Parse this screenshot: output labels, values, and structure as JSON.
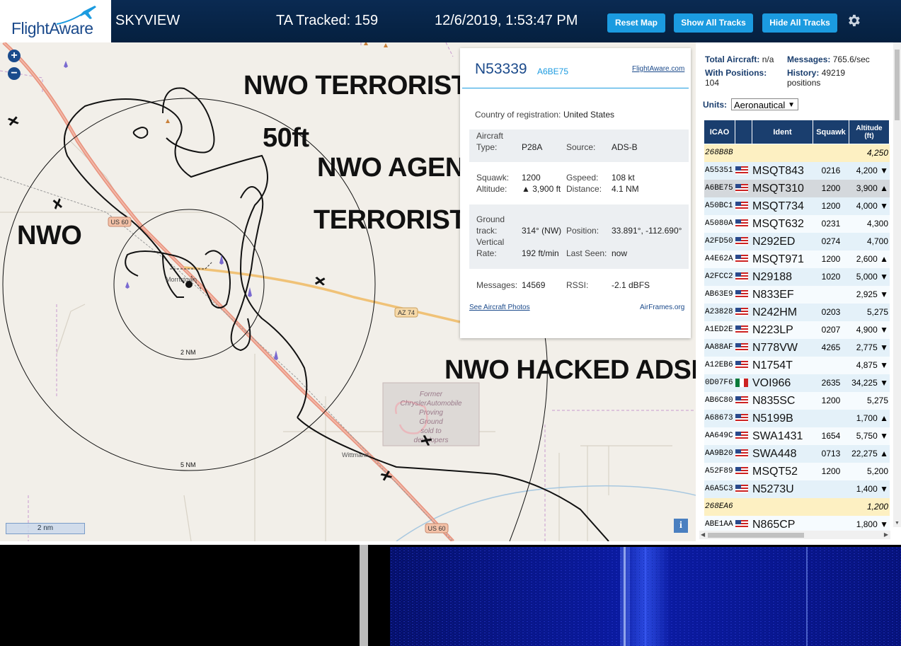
{
  "header": {
    "logo_text": "FlightAware",
    "app_name": "SKYVIEW",
    "tracked_label": "TA Tracked: 159",
    "datetime": "12/6/2019, 1:53:47 PM",
    "reset_map": "Reset Map",
    "show_all": "Show All Tracks",
    "hide_all": "Hide All Tracks",
    "settings_icon": "gear-icon"
  },
  "map": {
    "zoom_in": "+",
    "zoom_out": "−",
    "scale": "2 nm",
    "info": "i",
    "overlays": [
      "NWO TERRORIST",
      "50ft",
      "NWO AGENT",
      "TERRORIST",
      "NWO",
      "NWO HACKED ADSB"
    ],
    "labels": {
      "us60_a": "US 60",
      "us60_b": "US 60",
      "az74": "AZ 74",
      "morristown": "Morristown",
      "wittmann": "Wittmann",
      "ring_2nm": "2 NM",
      "ring_5nm": "5 NM",
      "proving_ground": [
        "Former",
        "ChryslerAutomobile",
        "Proving",
        "Ground",
        "sold to",
        "developers"
      ]
    }
  },
  "popup": {
    "registration": "N53339",
    "hex": "A6BE75",
    "fa_link": "FlightAware.com",
    "country_label": "Country of registration:",
    "country": "United States",
    "aircraft_type_label": [
      "Aircraft",
      "Type:"
    ],
    "aircraft_type": "P28A",
    "source_label": "Source:",
    "source": "ADS-B",
    "squawk_label": "Squawk:",
    "squawk": "1200",
    "gspeed_label": "Gspeed:",
    "gspeed": "108 kt",
    "altitude_label": "Altitude:",
    "altitude": "▲ 3,900 ft",
    "distance_label": "Distance:",
    "distance": "4.1 NM",
    "track_label": [
      "Ground",
      "track:"
    ],
    "track": "314° (NW)",
    "position_label": "Position:",
    "position": "33.891°, -112.690°",
    "vrate_label": [
      "Vertical",
      "Rate:"
    ],
    "vrate": "192 ft/min",
    "lastseen_label": "Last Seen:",
    "lastseen": "now",
    "messages_label": "Messages:",
    "messages": "14569",
    "rssi_label": "RSSI:",
    "rssi": "-2.1 dBFS",
    "photos_link": "See Aircraft Photos",
    "airframes_link": "AirFrames.org"
  },
  "sidebar": {
    "total_label": "Total Aircraft:",
    "total": "n/a",
    "messages_label": "Messages:",
    "messages": "765.6/sec",
    "withpos_label": "With Positions:",
    "withpos": "104",
    "history_label": "History:",
    "history": "49219",
    "history_unit": "positions",
    "units_label": "Units:",
    "units_value": "Aeronautical",
    "columns": [
      "ICAO",
      "",
      "Ident",
      "Squawk",
      "Altitude (ft)"
    ],
    "rows": [
      {
        "icao": "268B8B",
        "flag": "",
        "ident": "",
        "squawk": "",
        "alt": "4,250",
        "style": "mlat"
      },
      {
        "icao": "A55351",
        "flag": "us",
        "ident": "MSQT843",
        "squawk": "0216",
        "alt": "4,200 ▼",
        "style": "a"
      },
      {
        "icao": "A6BE75",
        "flag": "us",
        "ident": "MSQT310",
        "squawk": "1200",
        "alt": "3,900 ▲",
        "style": "sel"
      },
      {
        "icao": "A50BC1",
        "flag": "us",
        "ident": "MSQT734",
        "squawk": "1200",
        "alt": "4,000 ▼",
        "style": "a"
      },
      {
        "icao": "A5080A",
        "flag": "us",
        "ident": "MSQT632",
        "squawk": "0231",
        "alt": "4,300",
        "style": "b"
      },
      {
        "icao": "A2FD50",
        "flag": "us",
        "ident": "N292ED",
        "squawk": "0274",
        "alt": "4,700",
        "style": "a"
      },
      {
        "icao": "A4E62A",
        "flag": "us",
        "ident": "MSQT971",
        "squawk": "1200",
        "alt": "2,600 ▲",
        "style": "b"
      },
      {
        "icao": "A2FCC2",
        "flag": "us",
        "ident": "N29188",
        "squawk": "1020",
        "alt": "5,000 ▼",
        "style": "a"
      },
      {
        "icao": "AB63E9",
        "flag": "us",
        "ident": "N833EF",
        "squawk": "",
        "alt": "2,925 ▼",
        "style": "b"
      },
      {
        "icao": "A23828",
        "flag": "us",
        "ident": "N242HM",
        "squawk": "0203",
        "alt": "5,275",
        "style": "a"
      },
      {
        "icao": "A1ED2E",
        "flag": "us",
        "ident": "N223LP",
        "squawk": "0207",
        "alt": "4,900 ▼",
        "style": "b"
      },
      {
        "icao": "AA88AF",
        "flag": "us",
        "ident": "N778VW",
        "squawk": "4265",
        "alt": "2,775 ▼",
        "style": "a"
      },
      {
        "icao": "A12EB6",
        "flag": "us",
        "ident": "N1754T",
        "squawk": "",
        "alt": "4,875 ▼",
        "style": "b"
      },
      {
        "icao": "0D07F6",
        "flag": "mx",
        "ident": "VOI966",
        "squawk": "2635",
        "alt": "34,225 ▼",
        "style": "a"
      },
      {
        "icao": "AB6C80",
        "flag": "us",
        "ident": "N835SC",
        "squawk": "1200",
        "alt": "5,275",
        "style": "b"
      },
      {
        "icao": "A68673",
        "flag": "us",
        "ident": "N5199B",
        "squawk": "",
        "alt": "1,700 ▲",
        "style": "a"
      },
      {
        "icao": "AA649C",
        "flag": "us",
        "ident": "SWA1431",
        "squawk": "1654",
        "alt": "5,750 ▼",
        "style": "b"
      },
      {
        "icao": "AA9B20",
        "flag": "us",
        "ident": "SWA448",
        "squawk": "0713",
        "alt": "22,275 ▲",
        "style": "a"
      },
      {
        "icao": "A52F89",
        "flag": "us",
        "ident": "MSQT52",
        "squawk": "1200",
        "alt": "5,200",
        "style": "b"
      },
      {
        "icao": "A6A5C3",
        "flag": "us",
        "ident": "N5273U",
        "squawk": "",
        "alt": "1,400 ▼",
        "style": "a"
      },
      {
        "icao": "268EA6",
        "flag": "",
        "ident": "",
        "squawk": "",
        "alt": "1,200",
        "style": "mlat"
      },
      {
        "icao": "ABE1AA",
        "flag": "us",
        "ident": "N865CP",
        "squawk": "",
        "alt": "1,800 ▼",
        "style": "b"
      }
    ]
  },
  "colors": {
    "header_bg": "#0a2a52",
    "button_blue": "#1b9be0",
    "table_head": "#1a3e6e",
    "row_a": "#e4f1f9",
    "row_b": "#f6fbfe",
    "row_mlat": "#fdf0c2",
    "row_sel": "#d4d8dc"
  }
}
